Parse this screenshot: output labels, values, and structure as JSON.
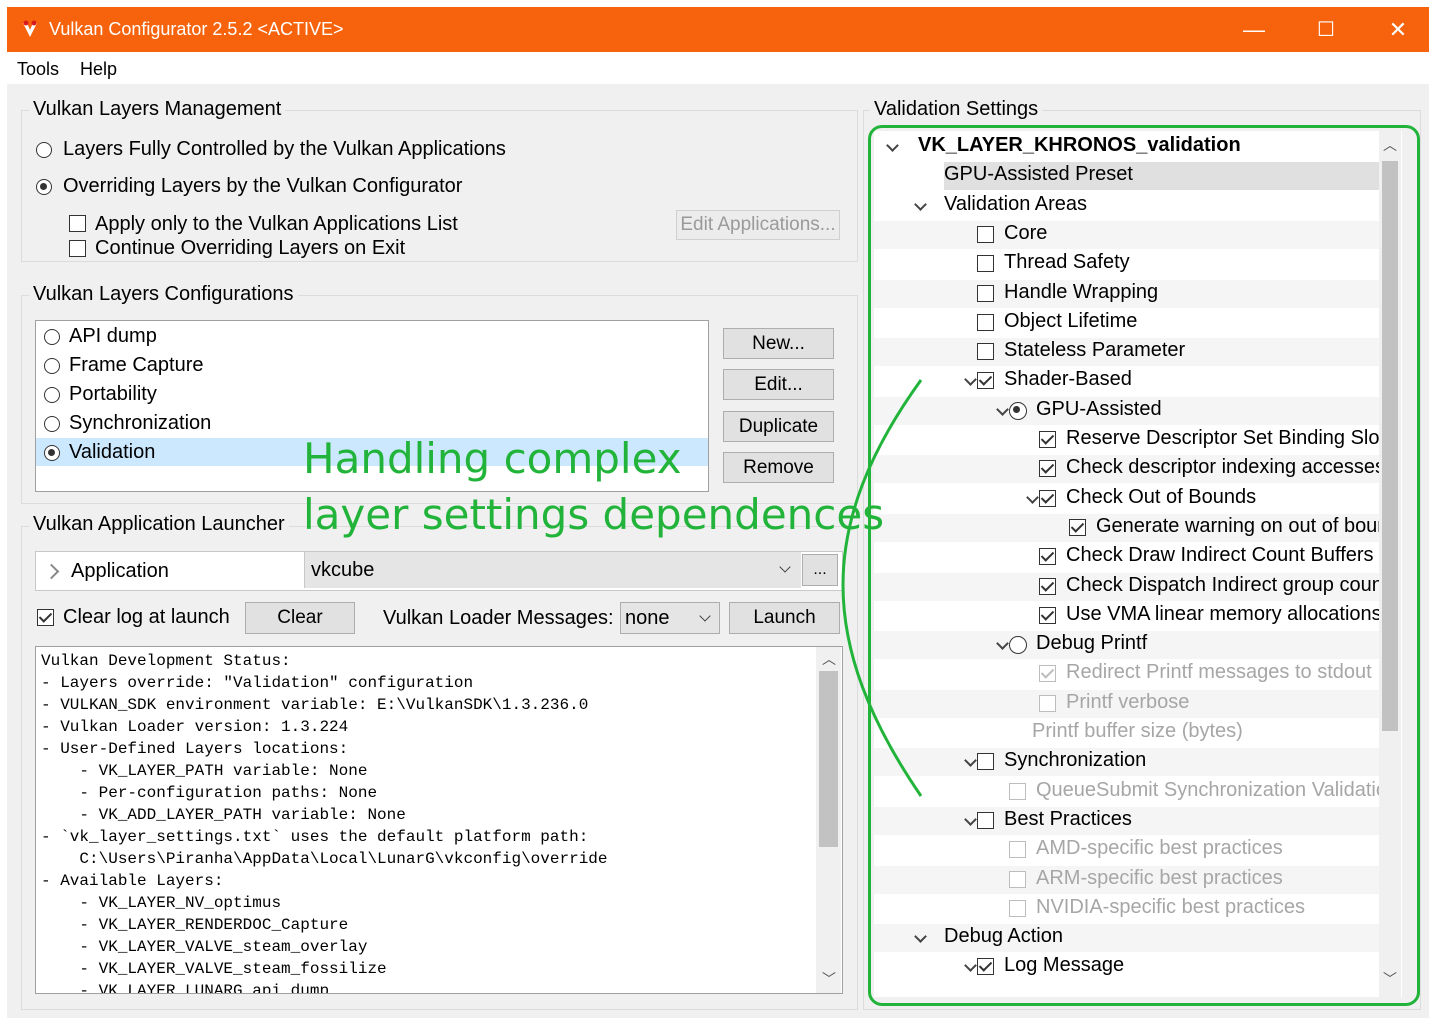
{
  "window": {
    "title": "Vulkan Configurator 2.5.2 <ACTIVE>",
    "minimize": "—",
    "maximize": "☐",
    "close": "✕"
  },
  "menu": [
    "Tools",
    "Help"
  ],
  "layers_management": {
    "title": "Vulkan Layers Management",
    "radio_apps": "Layers Fully Controlled by the Vulkan Applications",
    "radio_configurator": "Overriding Layers by the Vulkan Configurator",
    "apply_only": "Apply only to the Vulkan Applications List",
    "continue_override": "Continue Overriding Layers on Exit",
    "edit_apps": "Edit Applications..."
  },
  "configurations": {
    "title": "Vulkan Layers Configurations",
    "items": [
      "API dump",
      "Frame Capture",
      "Portability",
      "Synchronization",
      "Validation"
    ],
    "selected": "Validation",
    "buttons": {
      "new": "New...",
      "edit": "Edit...",
      "duplicate": "Duplicate",
      "remove": "Remove"
    }
  },
  "annotation": {
    "line1": "Handling complex",
    "line2": "layer settings dependences"
  },
  "launcher": {
    "title": "Vulkan Application Launcher",
    "application_label": "Application",
    "application_value": "vkcube",
    "browse": "...",
    "clear_log": "Clear log at launch",
    "clear": "Clear",
    "loader_messages_label": "Vulkan Loader Messages:",
    "loader_messages_value": "none",
    "launch": "Launch"
  },
  "log_lines": [
    "Vulkan Development Status:",
    "- Layers override: \"Validation\" configuration",
    "- VULKAN_SDK environment variable: E:\\VulkanSDK\\1.3.236.0",
    "- Vulkan Loader version: 1.3.224",
    "- User-Defined Layers locations:",
    "    - VK_LAYER_PATH variable: None",
    "    - Per-configuration paths: None",
    "    - VK_ADD_LAYER_PATH variable: None",
    "- `vk_layer_settings.txt` uses the default platform path:",
    "    C:\\Users\\Piranha\\AppData\\Local\\LunarG\\vkconfig\\override",
    "- Available Layers:",
    "    - VK_LAYER_NV_optimus",
    "    - VK_LAYER_RENDERDOC_Capture",
    "    - VK_LAYER_VALVE_steam_overlay",
    "    - VK_LAYER_VALVE_steam_fossilize",
    "    - VK_LAYER_LUNARG_api_dump"
  ],
  "validation_settings": {
    "title": "Validation Settings",
    "layer": "VK_LAYER_KHRONOS_validation",
    "preset": "GPU-Assisted Preset",
    "validation_areas": "Validation Areas",
    "core": "Core",
    "thread_safety": "Thread Safety",
    "handle_wrapping": "Handle Wrapping",
    "object_lifetime": "Object Lifetime",
    "stateless": "Stateless Parameter",
    "shader_based": "Shader-Based",
    "gpu_assisted": "GPU-Assisted",
    "reserve_desc": "Reserve Descriptor Set Binding Slot",
    "check_desc_indexing": "Check descriptor indexing accesses",
    "check_oob": "Check Out of Bounds",
    "gen_warning": "Generate warning on out of boun",
    "check_draw_indirect": "Check Draw Indirect Count Buffers a",
    "check_dispatch": "Check Dispatch Indirect group coun",
    "use_vma": "Use VMA linear memory allocations f",
    "debug_printf": "Debug Printf",
    "redirect_printf": "Redirect Printf messages to stdout",
    "printf_verbose": "Printf verbose",
    "printf_buffer": "Printf buffer size (bytes)",
    "synchronization": "Synchronization",
    "queue_submit": "QueueSubmit Synchronization Validatio",
    "best_practices": "Best Practices",
    "amd": "AMD-specific best practices",
    "arm": "ARM-specific best practices",
    "nvidia": "NVIDIA-specific best practices",
    "debug_action": "Debug Action",
    "log_message": "Log Message"
  },
  "colors": {
    "titlebar": "#f7630c",
    "annotation": "#22b43a",
    "selection": "#cce8ff"
  }
}
